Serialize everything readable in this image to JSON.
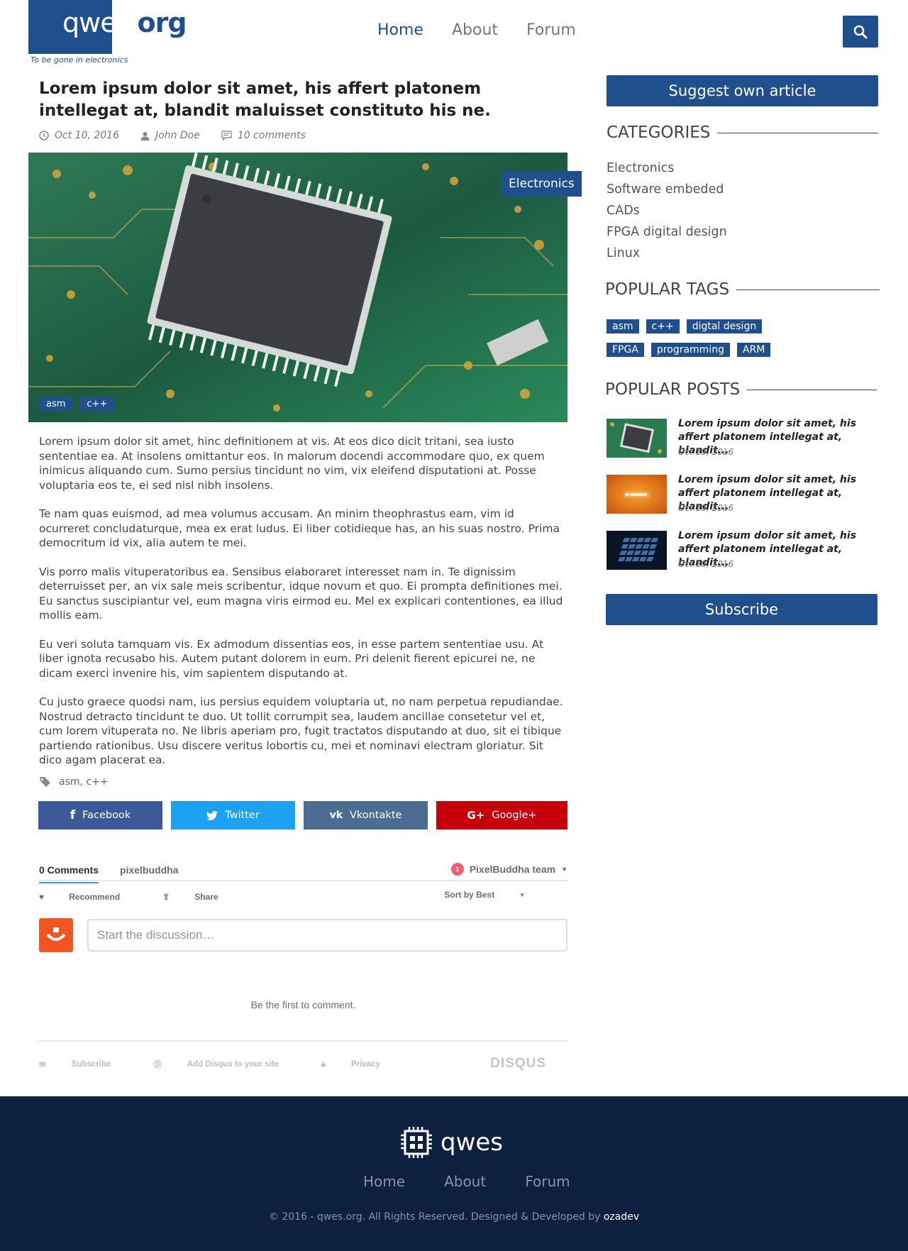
{
  "header": {
    "logo_main": "qwes",
    "logo_org": "org",
    "tagline": "To be gone in electronics",
    "nav": [
      {
        "label": "Home",
        "active": true
      },
      {
        "label": "About",
        "active": false
      },
      {
        "label": "Forum",
        "active": false
      }
    ],
    "search_icon": "search-icon"
  },
  "article": {
    "title": "Lorem ipsum dolor sit amet, his affert platonem intellegat at, blandit maluisset constituto his ne.",
    "date": "Oct 10, 2016",
    "author": "John Doe",
    "comments": "10 comments",
    "category": "Electronics",
    "image_tags": [
      "asm",
      "c++"
    ],
    "paragraphs": [
      "Lorem ipsum dolor sit amet, hinc definitionem at vis. At eos dico dicit tritani, sea iusto sententiae ea. At insolens omittantur eos. In malorum docendi accommodare quo, ex quem inimicus aliquando cum. Sumo persius tincidunt no vim, vix eleifend disputationi at. Posse voluptaria eos te, ei sed nisl nibh insolens.",
      "Te nam quas euismod, ad mea volumus accusam. An minim theophrastus eam, vim id ocurreret concludaturque, mea ex erat ludus. Ei liber cotidieque has, an his suas nostro. Prima democritum id vix, alia autem te mei.",
      "Vis porro malis vituperatoribus ea. Sensibus elaboraret interesset nam in. Te dignissim deterruisset per, an vix sale meis scribentur, idque novum et quo. Ei prompta definitiones mei. Eu sanctus suscipiantur vel, eum magna viris eirmod eu. Mel ex explicari contentiones, ea illud mollis eam.",
      "Eu veri soluta tamquam vis. Ex admodum dissentias eos, in esse partem sententiae usu. At liber ignota recusabo his. Autem putant dolorem in eum. Pri delenit fierent epicurei ne, ne dicam exerci invenire his, vim sapientem disputando at.",
      "Cu justo graece quodsi nam, ius persius equidem voluptaria ut, no nam perpetua repudiandae. Nostrud detracto tincidunt te duo. Ut tollit corrumpit sea, laudem ancillae consetetur vel et, cum lorem vituperata no. Ne libris aperiam pro, fugit tractatos disputando at duo, sit ei tibique partiendo rationibus. Usu discere veritus lobortis cu, mei et nominavi electram gloriatur. Sit dico agam placerat ea."
    ],
    "bottom_tags": "asm, c++"
  },
  "share": {
    "facebook": "Facebook",
    "twitter": "Twitter",
    "vkontakte": "Vkontakte",
    "googleplus": "Google+"
  },
  "comments": {
    "tab_comments": "0 Comments",
    "tab_site": "pixelbuddha",
    "notif_count": "1",
    "user": "PixelBuddha team",
    "recommend": "Recommend",
    "share": "Share",
    "sort": "Sort by Best",
    "placeholder": "Start the discussion…",
    "empty": "Be the first to comment.",
    "subscribe": "Subscribe",
    "add_disqus": "Add Disqus to your site",
    "privacy": "Privacy",
    "brand": "DISQUS"
  },
  "sidebar": {
    "suggest_button": "Suggest own article",
    "categories_title": "CATEGORIES",
    "categories": [
      "Electronics",
      "Software embeded",
      "CADs",
      "FPGA digital design",
      "Linux"
    ],
    "tags_title": "POPULAR TAGS",
    "tags": [
      "asm",
      "c++",
      "digtal design",
      "FPGA",
      "programming",
      "ARM"
    ],
    "posts_title": "POPULAR POSTS",
    "posts": [
      {
        "title": "Lorem ipsum dolor sit amet, his affert platonem intellegat at, blandit...",
        "date": "Oct 10, 2016"
      },
      {
        "title": "Lorem ipsum dolor sit amet, his affert platonem intellegat at, blandit...",
        "date": "Oct 10, 2016"
      },
      {
        "title": "Lorem ipsum dolor sit amet, his affert platonem intellegat at, blandit...",
        "date": "Oct 10, 2016"
      }
    ],
    "subscribe_button": "Subscribe"
  },
  "footer": {
    "logo": "qwes",
    "nav": [
      "Home",
      "About",
      "Forum"
    ],
    "copyright": "© 2016 - qwes.org. All Rights Reserved. Designed & Developed by",
    "developer": "ozadev"
  },
  "colors": {
    "brand": "#1f4f8c",
    "footer_bg": "#0e203f",
    "facebook": "#3b5998",
    "twitter": "#1da1f2",
    "vkontakte": "#4c6c91",
    "googleplus": "#c5000a"
  }
}
